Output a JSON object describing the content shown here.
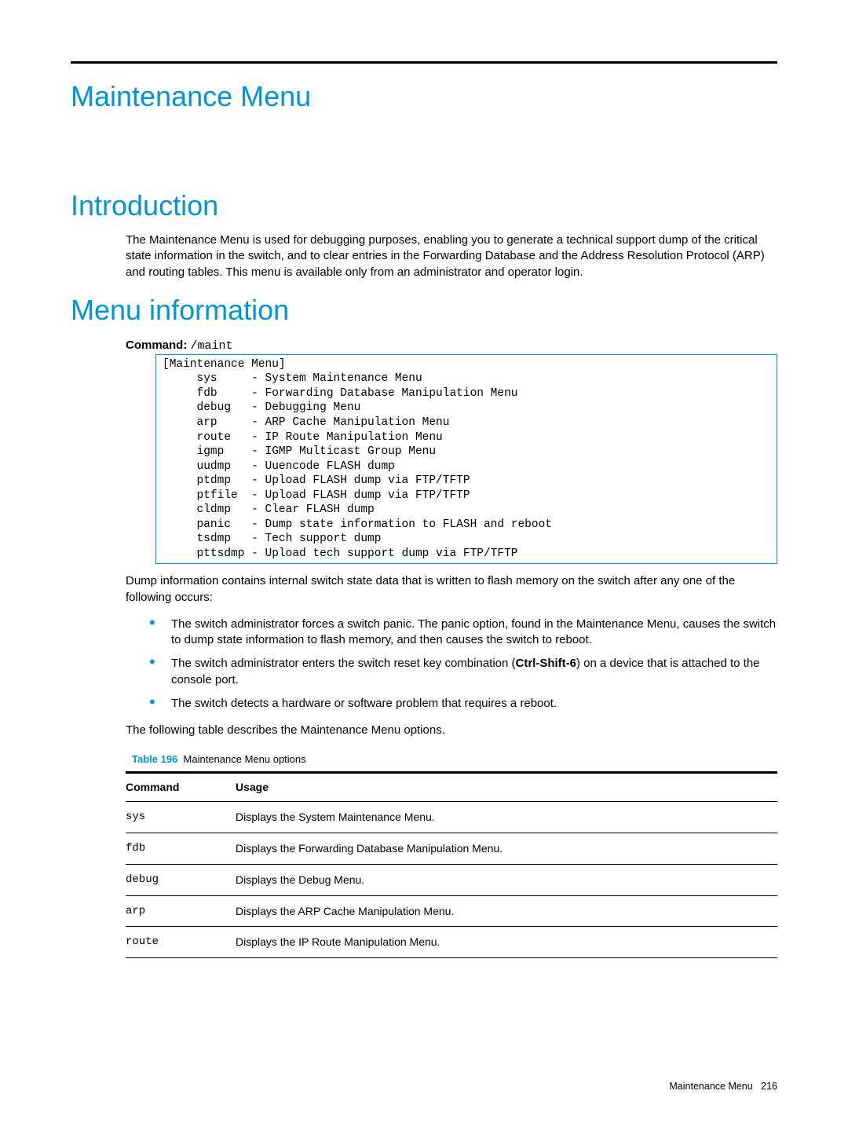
{
  "page": {
    "title": "Maintenance Menu",
    "footer_label": "Maintenance Menu",
    "footer_page": "216"
  },
  "intro": {
    "heading": "Introduction",
    "paragraph": "The Maintenance Menu is used for debugging purposes, enabling you to generate a technical support dump of the critical state information in the switch, and to clear entries in the Forwarding Database and the Address Resolution Protocol (ARP) and routing tables. This menu is available only from an administrator and operator login."
  },
  "menu_info": {
    "heading": "Menu information",
    "command_label": "Command:",
    "command_value": "/maint",
    "terminal": "[Maintenance Menu]\n     sys     - System Maintenance Menu\n     fdb     - Forwarding Database Manipulation Menu\n     debug   - Debugging Menu\n     arp     - ARP Cache Manipulation Menu\n     route   - IP Route Manipulation Menu\n     igmp    - IGMP Multicast Group Menu\n     uudmp   - Uuencode FLASH dump\n     ptdmp   - Upload FLASH dump via FTP/TFTP\n     ptfile  - Upload FLASH dump via FTP/TFTP\n     cldmp   - Clear FLASH dump\n     panic   - Dump state information to FLASH and reboot\n     tsdmp   - Tech support dump\n     pttsdmp - Upload tech support dump via FTP/TFTP",
    "after_terminal": "Dump information contains internal switch state data that is written to flash memory on the switch after any one of the following occurs:",
    "bullets": {
      "b1": "The switch administrator forces a switch panic. The panic option, found in the Maintenance Menu, causes the switch to dump state information to flash memory, and then causes the switch to reboot.",
      "b2_pre": "The switch administrator enters the switch reset key combination (",
      "b2_key": "Ctrl-Shift-6",
      "b2_post": ") on a device that is attached to the console port.",
      "b3": "The switch detects a hardware or software problem that requires a reboot."
    },
    "lead_out": "The following table describes the Maintenance Menu options."
  },
  "table": {
    "caption_num": "Table 196",
    "caption_text": "Maintenance Menu options",
    "headers": {
      "c1": "Command",
      "c2": "Usage"
    },
    "rows": [
      {
        "cmd": "sys",
        "usage": "Displays the System Maintenance Menu."
      },
      {
        "cmd": "fdb",
        "usage": "Displays the Forwarding Database Manipulation Menu."
      },
      {
        "cmd": "debug",
        "usage": "Displays the Debug Menu."
      },
      {
        "cmd": "arp",
        "usage": "Displays the ARP Cache Manipulation Menu."
      },
      {
        "cmd": "route",
        "usage": "Displays the IP Route Manipulation Menu."
      }
    ]
  }
}
